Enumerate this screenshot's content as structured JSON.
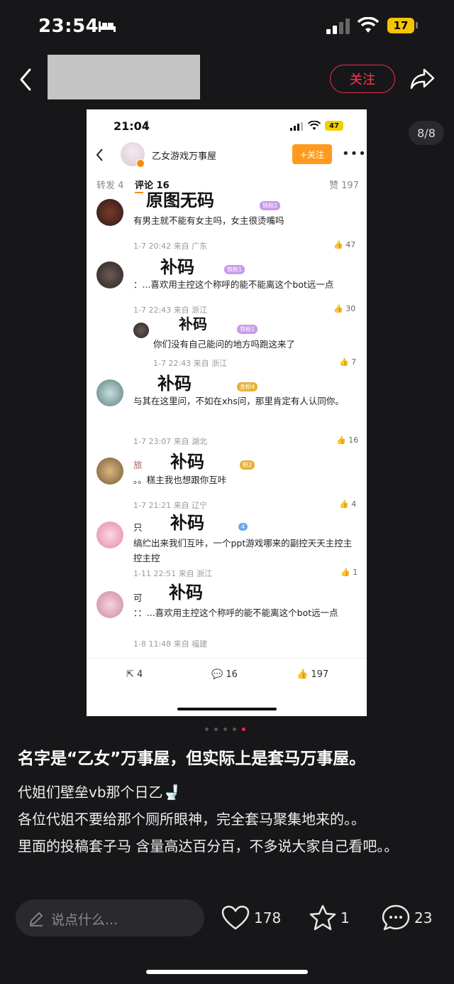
{
  "status_bar": {
    "time": "23:54",
    "battery": "17"
  },
  "header": {
    "follow_label": "关注",
    "page_indicator": "8/8"
  },
  "embedded": {
    "time": "21:04",
    "battery": "47",
    "account_title": "乙女游戏万事屋",
    "follow_label": "+关注",
    "tabs": {
      "repost": "转发 4",
      "comments": "评论 16",
      "likes": "赞 197"
    },
    "comments": [
      {
        "stamp": "原图无码",
        "badge": "铁粉2",
        "text": "有男主就不能有女主吗，女主很烫嘴吗",
        "meta": "1-7 20:42 来自 广东",
        "likes": "47"
      },
      {
        "stamp": "补码",
        "badge": "铁粉1",
        "text": "：...喜欢用主控这个称呼的能不能离这个bot远一点",
        "meta": "1-7 22:43 来自 浙江",
        "likes": "30"
      },
      {
        "stamp": "补码",
        "badge": "铁粉1",
        "text": "你们没有自己能问的地方吗跑这来了",
        "meta": "1-7 22:43 来自 浙江",
        "likes": "7"
      },
      {
        "stamp": "补码",
        "badge": "金粉4",
        "text": "与其在这里问，不如在xhs问，那里肯定有人认同你。",
        "meta": "1-7 23:07 来自 湖北",
        "likes": "16"
      },
      {
        "stamp": "补码",
        "prefix": "旅",
        "badge": "粉2",
        "text": "。。糕主我也想跟你互咔",
        "meta": "1-7 21:21 来自 辽宁",
        "likes": "4"
      },
      {
        "stamp": "补码",
        "prefix": "只",
        "badge": "4",
        "text": "缟纻出来我们互咔，一个ppt游戏哪来的副控天天主控主控主控",
        "meta": "1-11 22:51 来自 浙江",
        "likes": "1"
      },
      {
        "stamp": "补码",
        "prefix": "可",
        "text": "：：...喜欢用主控这个称呼的能不能离这个bot远一点",
        "meta": "1-8 11:48 来自 福建",
        "likes": ""
      }
    ],
    "bottom": {
      "repost": "4",
      "comments": "16",
      "likes": "197"
    }
  },
  "post": {
    "title": "名字是“乙女”万事屋，但实际上是套马万事屋。",
    "body_line1": "代姐们壁垒vb那个日乙🚽",
    "body_line2": "各位代姐不要给那个厕所眼神，完全套马聚集地来的。。",
    "body_line3": "里面的投稿套子马 含量高达百分百，不多说大家自己看吧。。"
  },
  "bottom_bar": {
    "placeholder": "说点什么...",
    "likes": "178",
    "favorites": "1",
    "comments": "23"
  }
}
